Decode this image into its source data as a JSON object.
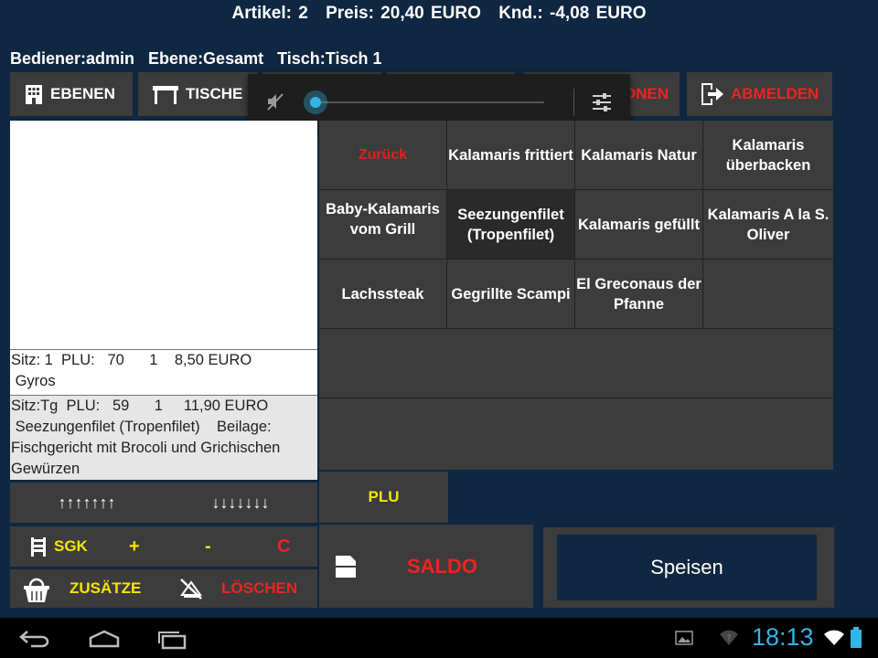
{
  "summary": {
    "artikel": "Artikel: 2",
    "preis": "Preis: 20,40 EURO",
    "knd": "Knd.: -4,08 EURO"
  },
  "info": {
    "bediener": "Bediener:admin",
    "ebene": "Ebene:Gesamt",
    "tisch": "Tisch:Tisch 1"
  },
  "toolbar": {
    "ebenen": "EBENEN",
    "tische": "TISCHE",
    "onen": "ONEN",
    "abmelden": "ABMELDEN"
  },
  "orders": [
    {
      "line1": "Sitz: 1  PLU:   70      1    8,50 EURO",
      "line2": " Gyros"
    },
    {
      "line1": "Sitz:Tg  PLU:   59      1     11,90 EURO",
      "line2": " Seezungenfilet (Tropenfilet)    Beilage:",
      "line3": "Fischgericht mit Brocoli und Grichischen",
      "line4": "Gewürzen"
    }
  ],
  "menu": {
    "zurueck": "Zurück",
    "items": [
      "Kalamaris frittiert",
      "Kalamaris Natur",
      "Kalamaris überbacken",
      "Baby-Kalamaris vom Grill",
      "Seezungenfilet (Tropenfilet)",
      "Kalamaris gefüllt",
      "Kalamaris A la S. Oliver",
      "Lachssteak",
      "Gegrillte Scampi",
      "El Greconaus der Pfanne"
    ]
  },
  "controls": {
    "up": "↑↑↑↑↑↑↑",
    "down": "↓↓↓↓↓↓↓",
    "sgk": "SGK",
    "plus": "+",
    "minus": "-",
    "c": "C",
    "zusaetze": "ZUSÄTZE",
    "loeschen": "LÖSCHEN",
    "plu": "PLU",
    "saldo": "SALDO",
    "speisen": "Speisen"
  },
  "statusbar": {
    "time": "18:13"
  },
  "volume": {
    "level": 0
  },
  "colors": {
    "background": "#0f2740",
    "button": "#3c3c3c",
    "accent_yellow": "#f6e600",
    "accent_red": "#ee2222",
    "clock": "#33b5e5"
  }
}
